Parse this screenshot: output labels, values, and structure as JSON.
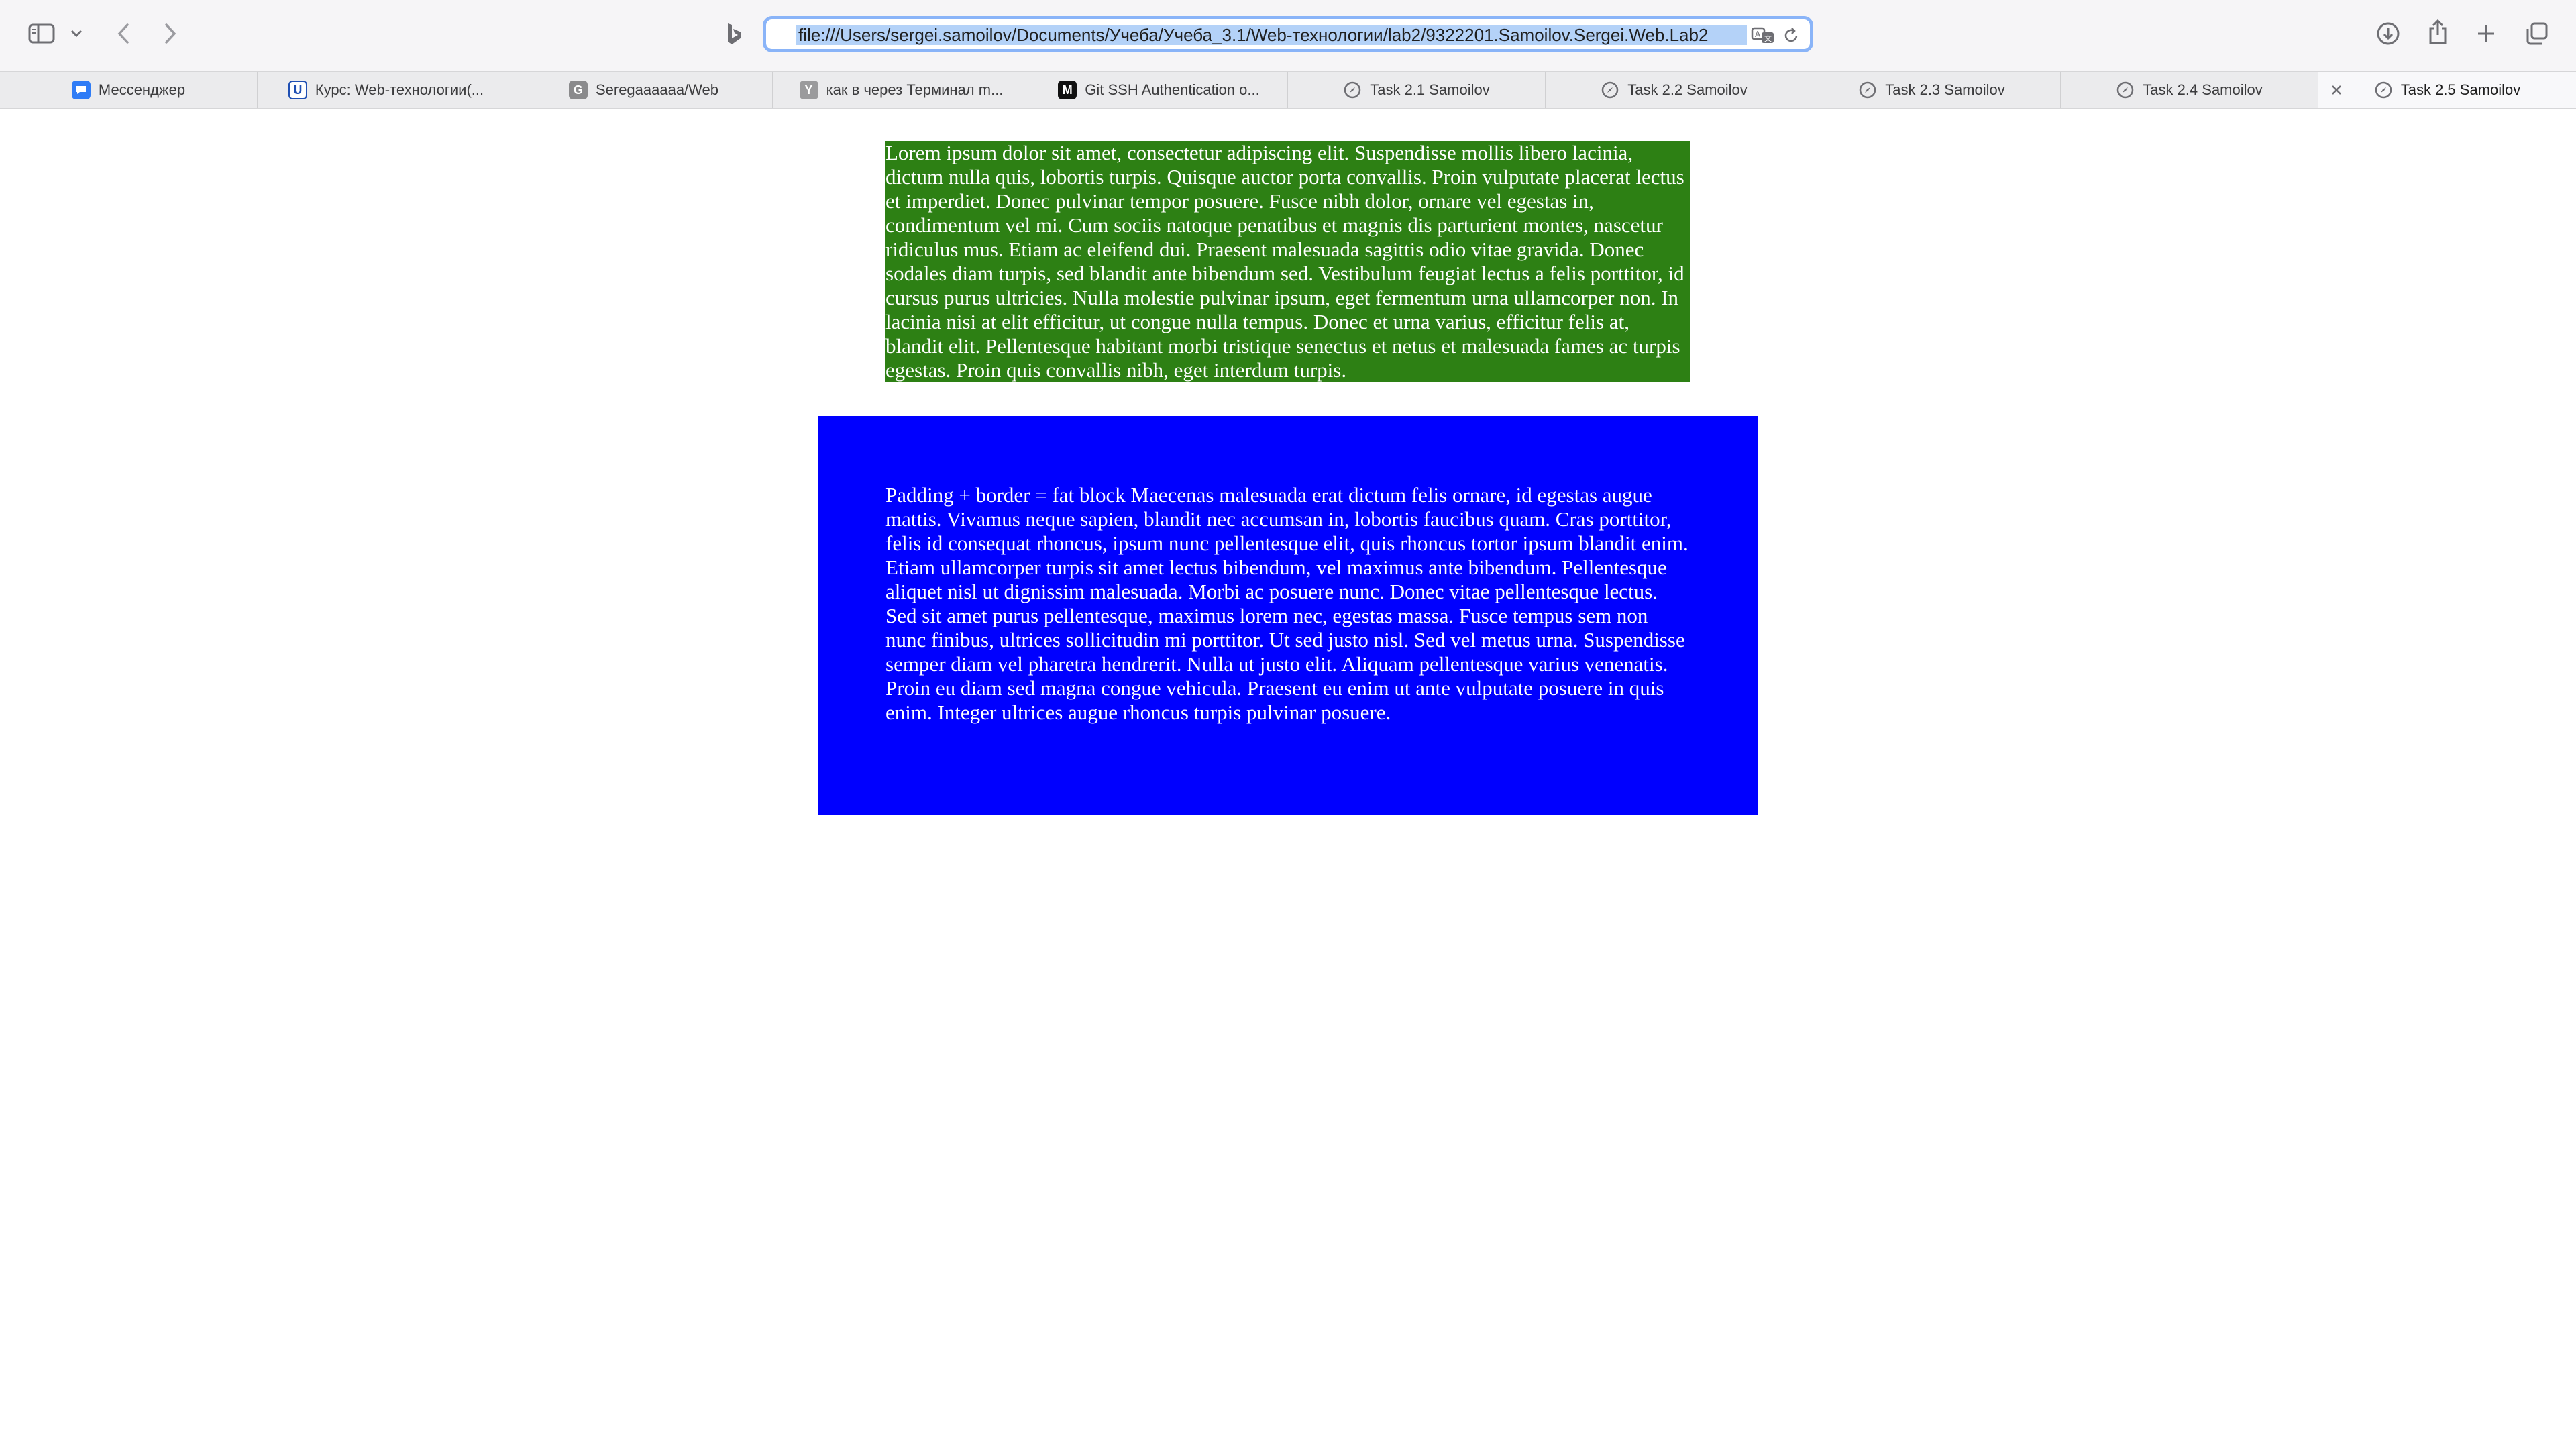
{
  "browser": {
    "address": "file:///Users/sergei.samoilov/Documents/Учеба/Учеба_3.1/Web-технологии/lab2/9322201.Samoilov.Sergei.Web.Lab2",
    "tabs": [
      {
        "label": "Мессенджер",
        "icon": "messenger-icon",
        "favicon_color": "#2f7cf6",
        "favicon_text": ""
      },
      {
        "label": "Курс: Web-технологии(...",
        "icon": "university-icon",
        "favicon_color": "#ffffff",
        "favicon_text": "U"
      },
      {
        "label": "Seregaaaaaa/Web",
        "icon": "github-icon",
        "favicon_color": "#8a8a8c",
        "favicon_text": "G"
      },
      {
        "label": "как в через Терминал m...",
        "icon": "yandex-icon",
        "favicon_color": "#9a9a9c",
        "favicon_text": "Y"
      },
      {
        "label": "Git SSH Authentication o...",
        "icon": "medium-icon",
        "favicon_color": "#111111",
        "favicon_text": "M"
      },
      {
        "label": "Task 2.1 Samoilov",
        "icon": "compass-icon",
        "favicon_color": "",
        "favicon_text": ""
      },
      {
        "label": "Task 2.2 Samoilov",
        "icon": "compass-icon",
        "favicon_color": "",
        "favicon_text": ""
      },
      {
        "label": "Task 2.3 Samoilov",
        "icon": "compass-icon",
        "favicon_color": "",
        "favicon_text": ""
      },
      {
        "label": "Task 2.4 Samoilov",
        "icon": "compass-icon",
        "favicon_color": "",
        "favicon_text": ""
      },
      {
        "label": "Task 2.5 Samoilov",
        "icon": "compass-icon",
        "favicon_color": "",
        "favicon_text": "",
        "active": true
      }
    ]
  },
  "page": {
    "green_block": {
      "text": "Lorem ipsum dolor sit amet, consectetur adipiscing elit. Suspendisse mollis libero lacinia, dictum nulla quis, lobortis turpis. Quisque auctor porta convallis. Proin vulputate placerat lectus et imperdiet. Donec pulvinar tempor posuere. Fusce nibh dolor, ornare vel egestas in, condimentum vel mi. Cum sociis natoque penatibus et magnis dis parturient montes, nascetur ridiculus mus. Etiam ac eleifend dui. Praesent malesuada sagittis odio vitae gravida. Donec sodales diam turpis, sed blandit ante bibendum sed. Vestibulum feugiat lectus a felis porttitor, id cursus purus ultricies. Nulla molestie pulvinar ipsum, eget fermentum urna ullamcorper non. In lacinia nisi at elit efficitur, ut congue nulla tempus. Donec et urna varius, efficitur felis at, blandit elit. Pellentesque habitant morbi tristique senectus et netus et malesuada fames ac turpis egestas. Proin quis convallis nibh, eget interdum turpis.",
      "background": "#2d8014"
    },
    "blue_block": {
      "text": "Padding + border = fat block Maecenas malesuada erat dictum felis ornare, id egestas augue mattis. Vivamus neque sapien, blandit nec accumsan in, lobortis faucibus quam. Cras porttitor, felis id consequat rhoncus, ipsum nunc pellentesque elit, quis rhoncus tortor ipsum blandit enim. Etiam ullamcorper turpis sit amet lectus bibendum, vel maximus ante bibendum. Pellentesque aliquet nisl ut dignissim malesuada. Morbi ac posuere nunc. Donec vitae pellentesque lectus. Sed sit amet purus pellentesque, maximus lorem nec, egestas massa. Fusce tempus sem non nunc finibus, ultrices sollicitudin mi porttitor. Ut sed justo nisl. Sed vel metus urna. Suspendisse semper diam vel pharetra hendrerit. Nulla ut justo elit. Aliquam pellentesque varius venenatis. Proin eu diam sed magna congue vehicula. Praesent eu enim ut ante vulputate posuere in quis enim. Integer ultrices augue rhoncus turpis pulvinar posuere.",
      "background": "#0000ff"
    }
  }
}
